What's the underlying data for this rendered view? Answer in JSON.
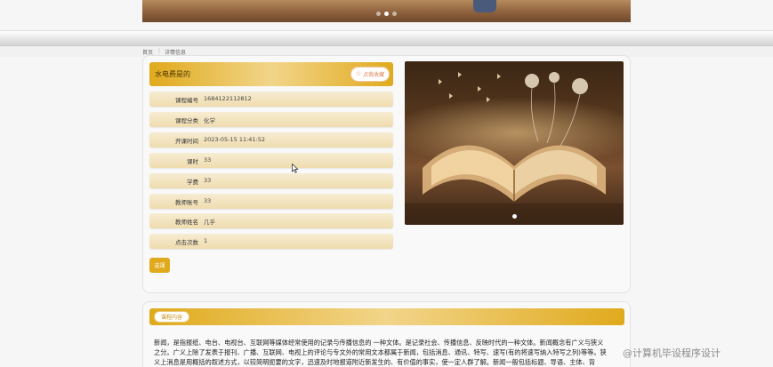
{
  "banner": {
    "dots": 3,
    "active_dot": 1
  },
  "breadcrumb": {
    "home": "首页",
    "separator": "|",
    "current": "详情信息"
  },
  "course": {
    "title": "水电费是的",
    "fav_button": "点我收藏",
    "fields": [
      {
        "label": "课程编号",
        "value": "1684122112812"
      },
      {
        "label": "课程分类",
        "value": "化学"
      },
      {
        "label": "开课时间",
        "value": "2023-05-15 11:41:52"
      },
      {
        "label": "课时",
        "value": "33"
      },
      {
        "label": "学费",
        "value": "33"
      },
      {
        "label": "教师账号",
        "value": "33"
      },
      {
        "label": "教师姓名",
        "value": "几乎"
      },
      {
        "label": "点击次数",
        "value": "1"
      }
    ],
    "action_button": "选课"
  },
  "section": {
    "tag": "课程内容",
    "lines": [
      "新闻，是指报纸、电台、电视台、互联网等媒体经常使用的记录与传播信息的 一种文体。是记录社会、传播信息、反映时代的一种文体。新闻概念有广义与狭义",
      "之分。广义上除了发表于报刊、广播、互联网、电视上的评论与专文外的常用文本都属于新闻，包括消息、通讯、特写、速写(有的将速写纳入特写之列)等等。狭",
      "义上消息是用概括的叙述方式，以较简明扼要的文字，迅速及时地报道附近新发生的、有价值的事实，使一定人群了解。新闻一般包括标题、导语、主体、背"
    ]
  },
  "watermark": "@计算机毕设程序设计",
  "colors": {
    "accent": "#e0aa1c",
    "row_bg": "#f3e4bf"
  }
}
